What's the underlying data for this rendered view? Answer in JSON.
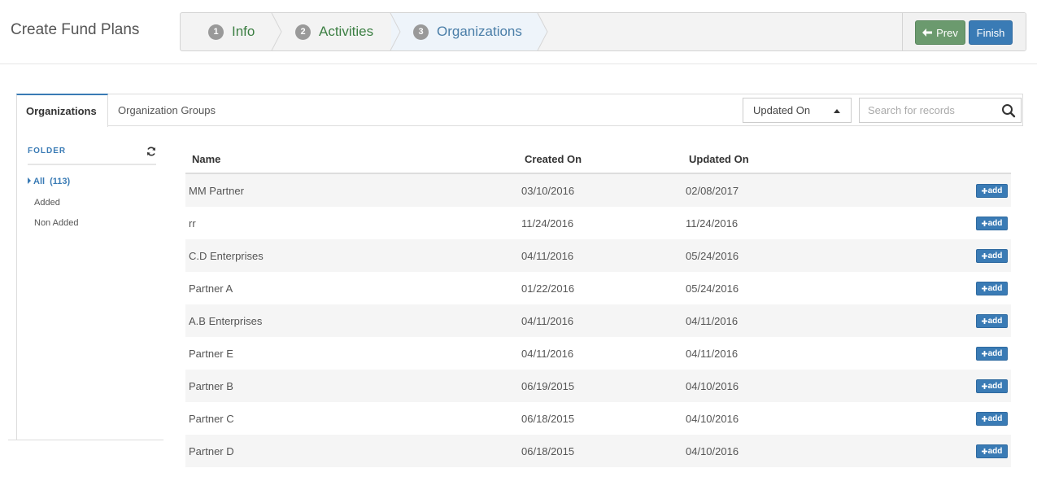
{
  "page": {
    "title": "Create Fund Plans"
  },
  "wizard": {
    "steps": [
      {
        "num": "1",
        "label": "Info"
      },
      {
        "num": "2",
        "label": "Activities"
      },
      {
        "num": "3",
        "label": "Organizations"
      }
    ],
    "prev_label": "Prev",
    "finish_label": "Finish"
  },
  "tabs": [
    {
      "label": "Organizations"
    },
    {
      "label": "Organization Groups"
    }
  ],
  "toolbar": {
    "sort_label": "Updated On",
    "search_placeholder": "Search for records"
  },
  "sidebar": {
    "header": "FOLDER",
    "all_label": "All",
    "all_count": "(113)",
    "items": [
      {
        "label": "Added"
      },
      {
        "label": "Non Added"
      }
    ]
  },
  "table": {
    "headers": {
      "name": "Name",
      "created": "Created On",
      "updated": "Updated On"
    },
    "add_label": "add",
    "rows": [
      {
        "name": "MM Partner",
        "created": "03/10/2016",
        "updated": "02/08/2017"
      },
      {
        "name": "rr",
        "created": "11/24/2016",
        "updated": "11/24/2016"
      },
      {
        "name": "C.D Enterprises",
        "created": "04/11/2016",
        "updated": "05/24/2016"
      },
      {
        "name": "Partner A",
        "created": "01/22/2016",
        "updated": "05/24/2016"
      },
      {
        "name": "A.B Enterprises",
        "created": "04/11/2016",
        "updated": "04/11/2016"
      },
      {
        "name": "Partner E",
        "created": "04/11/2016",
        "updated": "04/11/2016"
      },
      {
        "name": "Partner B",
        "created": "06/19/2015",
        "updated": "04/10/2016"
      },
      {
        "name": "Partner C",
        "created": "06/18/2015",
        "updated": "04/10/2016"
      },
      {
        "name": "Partner D",
        "created": "06/18/2015",
        "updated": "04/10/2016"
      }
    ]
  }
}
